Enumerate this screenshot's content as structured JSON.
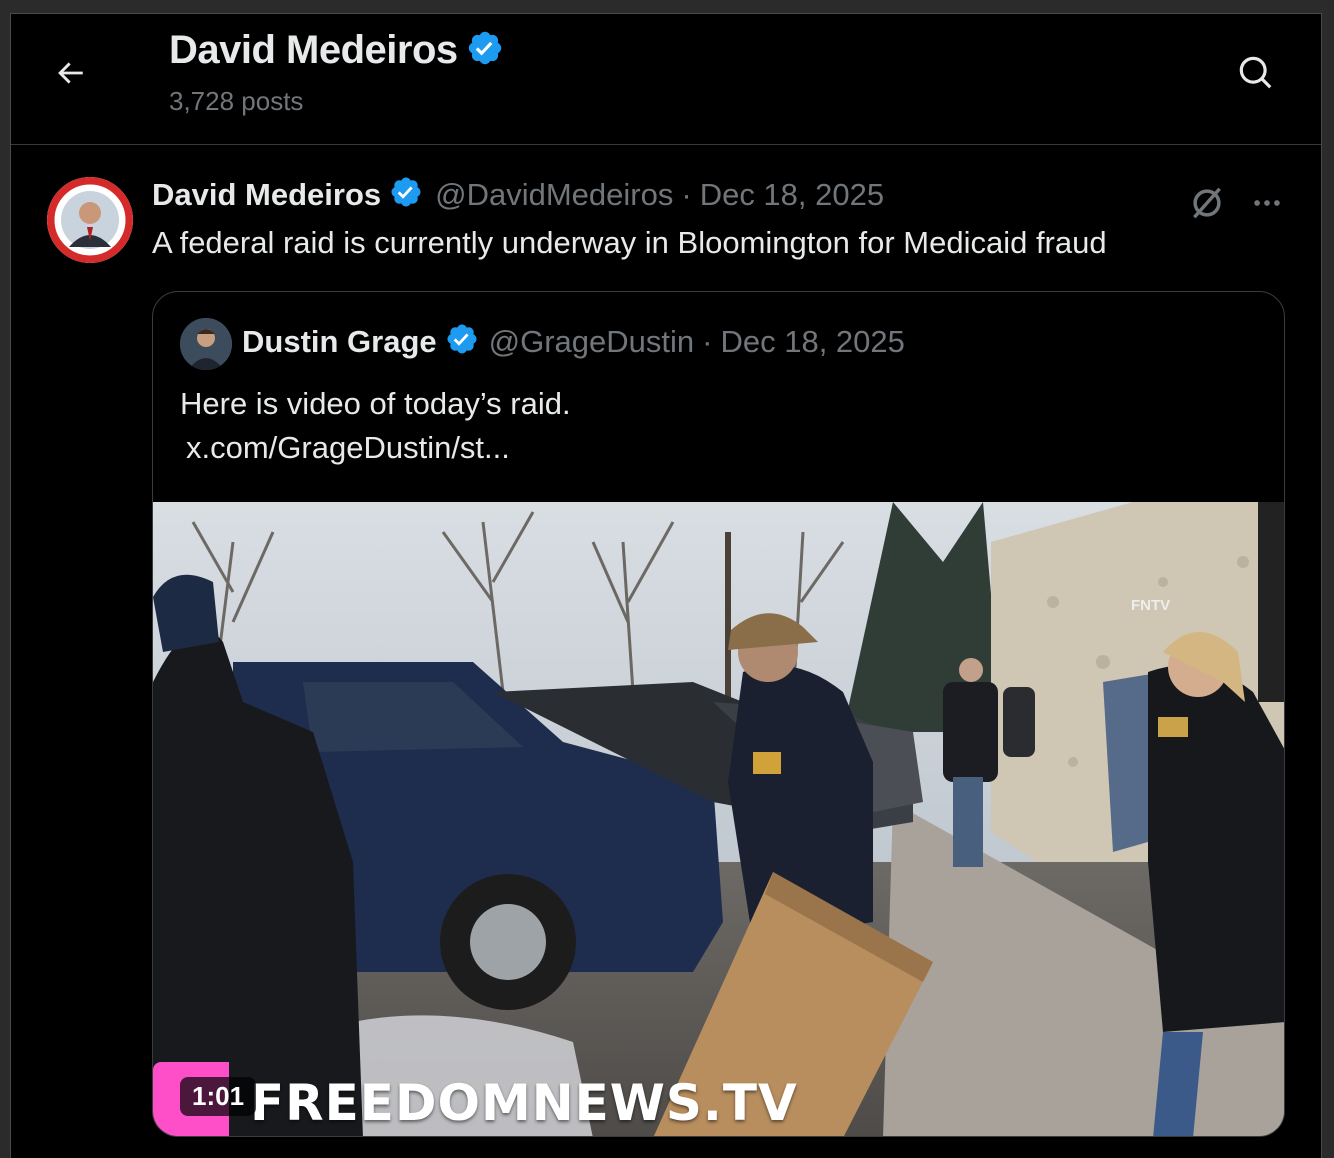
{
  "header": {
    "title": "David Medeiros",
    "posts_count": "3,728 posts"
  },
  "post": {
    "author_name": "David Medeiros",
    "handle": "@DavidMedeiros",
    "separator": "·",
    "date": "Dec 18, 2025",
    "text": "A federal raid is currently underway in Bloomington for Medicaid fraud",
    "more_icon": "more-icon",
    "grok_icon": "grok-icon"
  },
  "quote": {
    "author_name": "Dustin Grage",
    "handle": "@GrageDustin",
    "separator": "·",
    "date": "Dec 18, 2025",
    "text": "Here is video of today’s raid.",
    "link": "x.com/GrageDustin/st...",
    "video": {
      "duration": "1:01",
      "watermark": "FREEDOMNEWS.TV",
      "corner_logo": "FNTV"
    }
  },
  "colors": {
    "background": "#000000",
    "text": "#e7e9ea",
    "secondary": "#71767b",
    "verified": "#1d9bf0"
  }
}
